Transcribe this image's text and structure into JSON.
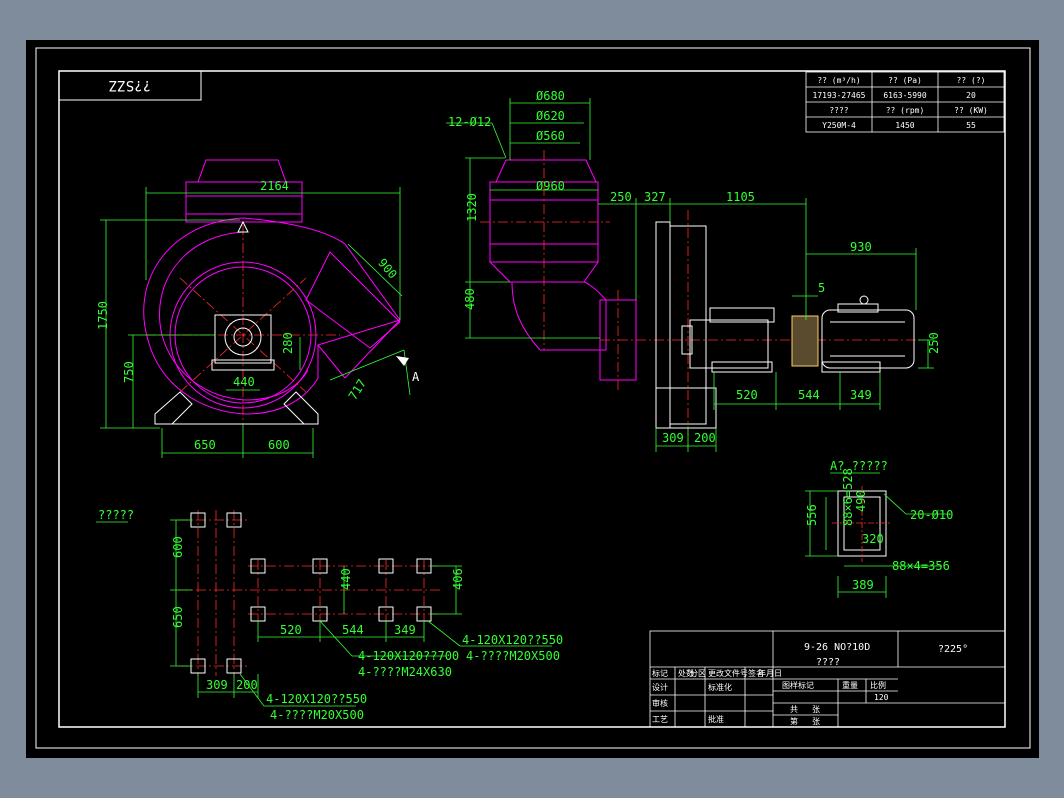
{
  "colors": {
    "background": "#000000",
    "chrome": "#7f8c9c",
    "border": "#ffffff",
    "outline": "#ff00ff",
    "centerline": "#ff2a2a",
    "dimension": "#33ff33",
    "equipment": "#ffffff",
    "coupling": "#ffcc66"
  },
  "corner_label": "??SZZ",
  "spec_table": {
    "headers": [
      "?? (m³/h)",
      "?? (Pa)",
      "?? (?)",
      "????",
      "?? (rpm)",
      "?? (KW)"
    ],
    "values": [
      "17193-27465",
      "6163-5990",
      "20",
      "Y250M-4",
      "1450",
      "55"
    ]
  },
  "front_view": {
    "dims": [
      "2164",
      "900",
      "1750",
      "750",
      "280",
      "440",
      "717",
      "650",
      "600"
    ],
    "view_arrow": "A"
  },
  "side_view": {
    "dims": [
      "Ø680",
      "Ø620",
      "Ø560",
      "12-Ø12",
      "Ø960",
      "1320",
      "480",
      "250",
      "327",
      "1105",
      "930",
      "5",
      "250",
      "520",
      "544",
      "349",
      "309",
      "200"
    ]
  },
  "view_a": {
    "title": "A? ?????",
    "dims": [
      "556",
      "88×6=528",
      "490",
      "320",
      "20-Ø10",
      "88×4=356",
      "389"
    ]
  },
  "foundation_plan": {
    "title": "?????",
    "dims": [
      "600",
      "650",
      "440",
      "406",
      "520",
      "544",
      "349",
      "309",
      "200"
    ],
    "notes": {
      "a1": "4-120X120??550",
      "a2": "4-????M20X500",
      "b1": "4-120X120??700",
      "b2": "4-????M24X630",
      "c1": "4-120X120??550",
      "c2": "4-????M20X500"
    }
  },
  "title_block": {
    "drawing_title": "9-26 NO?10D",
    "drawing_subtitle": "????",
    "right_label": "?225°",
    "cells": [
      "标记",
      "处数",
      "分区",
      "更改文件号",
      "签名",
      "年月日",
      "设计",
      "标准化",
      "图样标记",
      "重量",
      "比例",
      "审核",
      "工艺",
      "批准",
      "共",
      "张",
      "第",
      "张",
      "120"
    ]
  }
}
